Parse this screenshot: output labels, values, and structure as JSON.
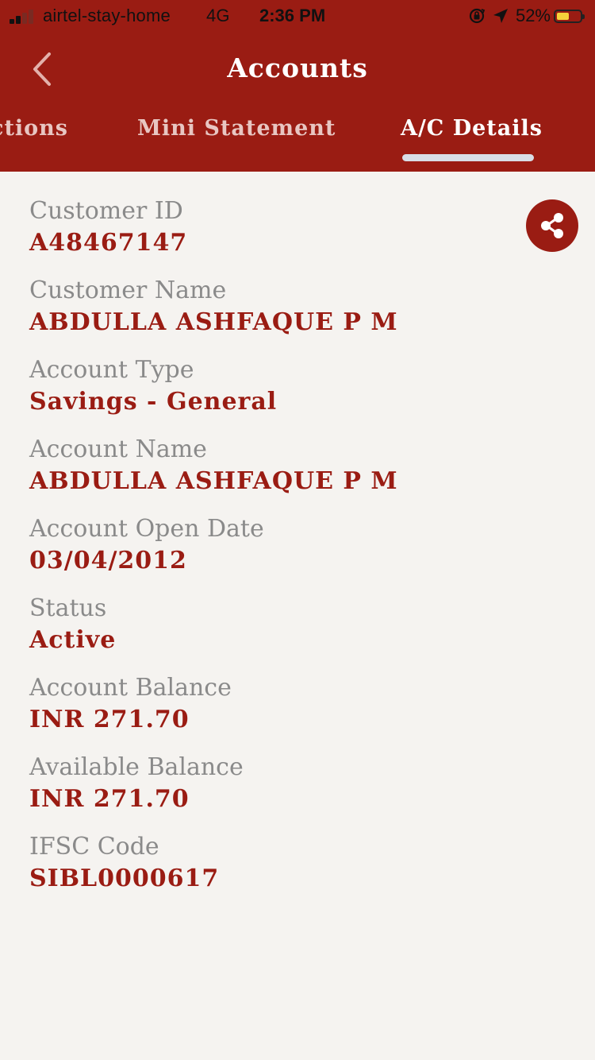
{
  "status_bar": {
    "carrier": "airtel-stay-home",
    "network": "4G",
    "time": "2:36 PM",
    "battery_percent": "52%",
    "battery_level": 0.52,
    "signal_bars_filled": 2,
    "signal_bars_total": 4,
    "icons": [
      "orientation-lock-icon",
      "location-arrow-icon",
      "battery-icon"
    ]
  },
  "header": {
    "title": "Accounts",
    "back_icon": "chevron-left-icon"
  },
  "tabs": [
    {
      "label": "ctions",
      "active": false
    },
    {
      "label": "Mini Statement",
      "active": false
    },
    {
      "label": "A/C Details",
      "active": true
    }
  ],
  "share_icon": "share-icon",
  "details": [
    {
      "label": "Customer ID",
      "value": "A48467147"
    },
    {
      "label": "Customer Name",
      "value": "ABDULLA ASHFAQUE P M"
    },
    {
      "label": "Account Type",
      "value": "Savings - General"
    },
    {
      "label": "Account Name",
      "value": "ABDULLA ASHFAQUE P M"
    },
    {
      "label": "Account Open Date",
      "value": "03/04/2012"
    },
    {
      "label": "Status",
      "value": "Active"
    },
    {
      "label": "Account Balance",
      "value": "INR 271.70"
    },
    {
      "label": "Available Balance",
      "value": "INR 271.70"
    },
    {
      "label": "IFSC Code",
      "value": "SIBL0000617"
    }
  ],
  "colors": {
    "brand": "#9a1c13",
    "label_gray": "#8a8a8a",
    "background": "#f5f3f0",
    "battery_fill": "#f5d23a"
  }
}
